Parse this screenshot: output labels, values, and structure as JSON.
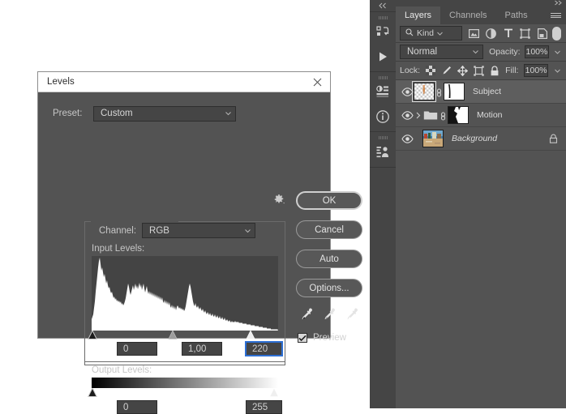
{
  "dialog": {
    "title": "Levels",
    "close_icon": "close-icon",
    "preset": {
      "label": "Preset:",
      "value": "Custom",
      "gear_icon": "gear-options-icon"
    },
    "channel": {
      "label": "Channel:",
      "value": "RGB"
    },
    "input_levels": {
      "label": "Input Levels:",
      "black": "0",
      "gamma": "1,00",
      "white": "220",
      "focused_field": "white"
    },
    "output_levels": {
      "label": "Output Levels:",
      "black": "0",
      "white": "255"
    },
    "buttons": {
      "ok": "OK",
      "cancel": "Cancel",
      "auto": "Auto",
      "options": "Options..."
    },
    "eyedroppers": [
      "eyedropper-black-point-icon",
      "eyedropper-gray-point-icon",
      "eyedropper-white-point-icon"
    ],
    "preview": {
      "label": "Preview",
      "checked": true
    }
  },
  "dock": {
    "collapse_icon": "collapse-double-chevron-left-icon",
    "icons": [
      "history-actions-icon",
      "play-action-icon",
      "adjustments-icon",
      "info-icon",
      "libraries-icon"
    ]
  },
  "panel": {
    "expand_icon": "expand-double-chevron-right-icon",
    "menu_icon": "panel-menu-icon",
    "tabs": [
      {
        "label": "Layers",
        "active": true
      },
      {
        "label": "Channels",
        "active": false
      },
      {
        "label": "Paths",
        "active": false
      }
    ],
    "filter": {
      "search_icon": "search-kind-icon",
      "kind_label": "Kind",
      "icons": [
        "filter-pixel-layers-icon",
        "filter-adjustment-layers-icon",
        "filter-type-layers-icon",
        "filter-shape-layers-icon",
        "filter-smart-object-icon"
      ],
      "toggle": "filter-enable-toggle"
    },
    "blend": {
      "mode": "Normal",
      "opacity_label": "Opacity:",
      "opacity_value": "100%"
    },
    "lock": {
      "label": "Lock:",
      "icons": [
        "lock-transparent-pixels-icon",
        "lock-image-pixels-icon",
        "lock-position-icon",
        "lock-artboard-nesting-icon",
        "lock-all-icon"
      ],
      "fill_label": "Fill:",
      "fill_value": "100%"
    },
    "layers": [
      {
        "name": "Subject",
        "visible": true,
        "selected": true,
        "thumb_type": "transparent-pixel-thumbnail",
        "has_mask": true,
        "linked": true,
        "locked": false,
        "italic": false,
        "is_group": false
      },
      {
        "name": "Motion",
        "visible": true,
        "selected": false,
        "thumb_type": "group-folder-icon",
        "has_mask": true,
        "linked": true,
        "locked": false,
        "italic": false,
        "is_group": true
      },
      {
        "name": "Background",
        "visible": true,
        "selected": false,
        "thumb_type": "photo-thumbnail",
        "has_mask": false,
        "linked": false,
        "locked": true,
        "italic": true,
        "is_group": false
      }
    ]
  },
  "colors": {
    "dialog_bg": "#535353",
    "panel_bg": "#535353",
    "dock_bg": "#454545",
    "field_bg": "#454545",
    "focus_blue": "#2d6fd4",
    "histogram_bg": "#444444",
    "histogram_fill": "#ffffff",
    "text": "#d2d2d2"
  }
}
